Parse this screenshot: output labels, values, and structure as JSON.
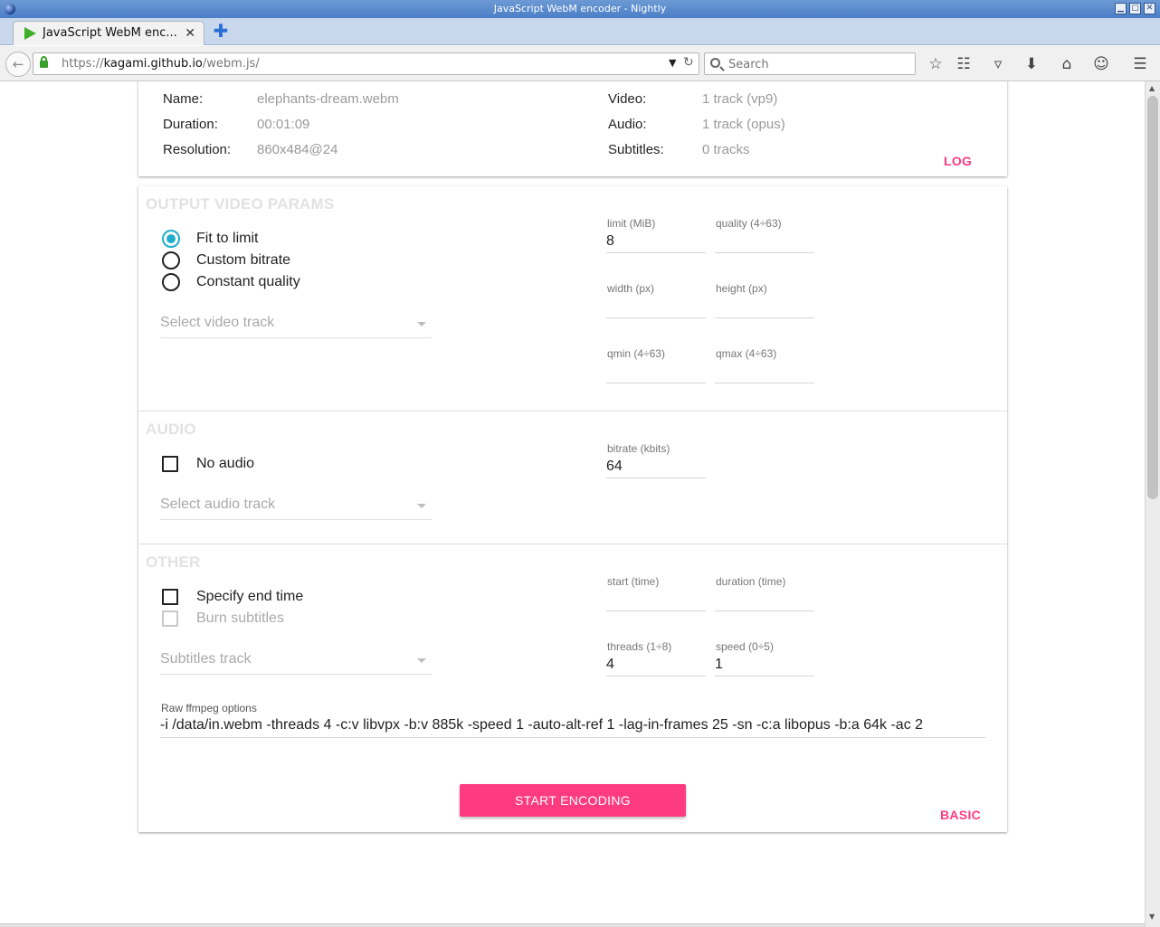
{
  "window": {
    "title": "JavaScript WebM encoder - Nightly",
    "controls": [
      "▁",
      "▢",
      "✕"
    ]
  },
  "tab": {
    "title": "JavaScript WebM enc...",
    "close": "✕",
    "new_tab": "✚"
  },
  "nav": {
    "url_prefix": "https://",
    "url_host": "kagami.github.io",
    "url_path": "/webm.js/",
    "search_placeholder": "Search",
    "icons": [
      "star-icon",
      "reading-list-icon",
      "pocket-icon",
      "download-icon",
      "home-icon",
      "chat-icon",
      "menu-icon"
    ]
  },
  "info": {
    "left": [
      {
        "key": "Name:",
        "value": "elephants-dream.webm"
      },
      {
        "key": "Duration:",
        "value": "00:01:09"
      },
      {
        "key": "Resolution:",
        "value": "860x484@24"
      }
    ],
    "right": [
      {
        "key": "Video:",
        "value": "1 track (vp9)"
      },
      {
        "key": "Audio:",
        "value": "1 track (opus)"
      },
      {
        "key": "Subtitles:",
        "value": "0 tracks"
      }
    ],
    "log_label": "LOG"
  },
  "video": {
    "title": "OUTPUT VIDEO PARAMS",
    "modes": [
      {
        "label": "Fit to limit",
        "checked": true
      },
      {
        "label": "Custom bitrate",
        "checked": false
      },
      {
        "label": "Constant quality",
        "checked": false
      }
    ],
    "track_select": "Select video track",
    "fields": [
      {
        "label": "limit (MiB)",
        "value": "8"
      },
      {
        "label": "quality (4÷63)",
        "value": ""
      },
      {
        "label": "width (px)",
        "value": ""
      },
      {
        "label": "height (px)",
        "value": ""
      },
      {
        "label": "qmin (4÷63)",
        "value": ""
      },
      {
        "label": "qmax (4÷63)",
        "value": ""
      }
    ]
  },
  "audio": {
    "title": "AUDIO",
    "no_audio_label": "No audio",
    "track_select": "Select audio track",
    "bitrate_label": "bitrate (kbits)",
    "bitrate_value": "64"
  },
  "other": {
    "title": "OTHER",
    "end_time_label": "Specify end time",
    "burn_subs_label": "Burn subtitles",
    "subs_select": "Subtitles track",
    "fields": [
      {
        "label": "start (time)",
        "value": ""
      },
      {
        "label": "duration (time)",
        "value": ""
      },
      {
        "label": "threads (1÷8)",
        "value": "4"
      },
      {
        "label": "speed (0÷5)",
        "value": "1"
      }
    ],
    "raw_label": "Raw ffmpeg options",
    "raw_value": "-i /data/in.webm -threads 4 -c:v libvpx -b:v 885k -speed 1 -auto-alt-ref 1 -lag-in-frames 25 -sn -c:a libopus -b:a 64k -ac 2"
  },
  "actions": {
    "start_label": "START ENCODING",
    "basic_label": "BASIC"
  },
  "colors": {
    "accent": "#ff3b80",
    "radio": "#1faecb",
    "section_title": "#e2e2e2"
  }
}
